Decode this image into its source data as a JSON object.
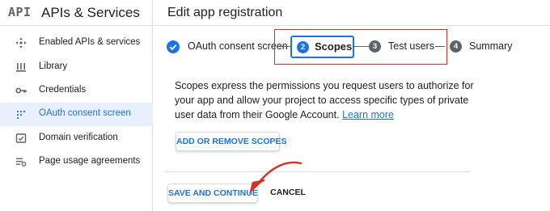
{
  "app": {
    "logo_text": "API",
    "title": "APIs & Services"
  },
  "sidebar": {
    "items": [
      {
        "label": "Enabled APIs & services",
        "icon": "enabled-apis-icon",
        "active": false
      },
      {
        "label": "Library",
        "icon": "library-icon",
        "active": false
      },
      {
        "label": "Credentials",
        "icon": "key-icon",
        "active": false
      },
      {
        "label": "OAuth consent screen",
        "icon": "oauth-consent-icon",
        "active": true
      },
      {
        "label": "Domain verification",
        "icon": "domain-verification-icon",
        "active": false
      },
      {
        "label": "Page usage agreements",
        "icon": "page-usage-icon",
        "active": false
      }
    ]
  },
  "page": {
    "title": "Edit app registration"
  },
  "stepper": {
    "steps": [
      {
        "number": "",
        "label": "OAuth consent screen",
        "status": "completed"
      },
      {
        "number": "2",
        "label": "Scopes",
        "status": "current"
      },
      {
        "number": "3",
        "label": "Test users",
        "status": "upcoming"
      },
      {
        "number": "4",
        "label": "Summary",
        "status": "upcoming"
      }
    ]
  },
  "content": {
    "description": "Scopes express the permissions you request users to authorize for your app and allow your project to access specific types of private user data from their Google Account.",
    "learn_more": "Learn more",
    "add_scopes_button": "ADD OR REMOVE SCOPES"
  },
  "actions": {
    "save_label": "SAVE AND CONTINUE",
    "cancel_label": "CANCEL"
  },
  "colors": {
    "accent": "#1a73e8",
    "active_bg": "#e8f0fe",
    "annotation": "#d93025",
    "step_inactive": "#5f6368",
    "divider": "#dadce0"
  }
}
